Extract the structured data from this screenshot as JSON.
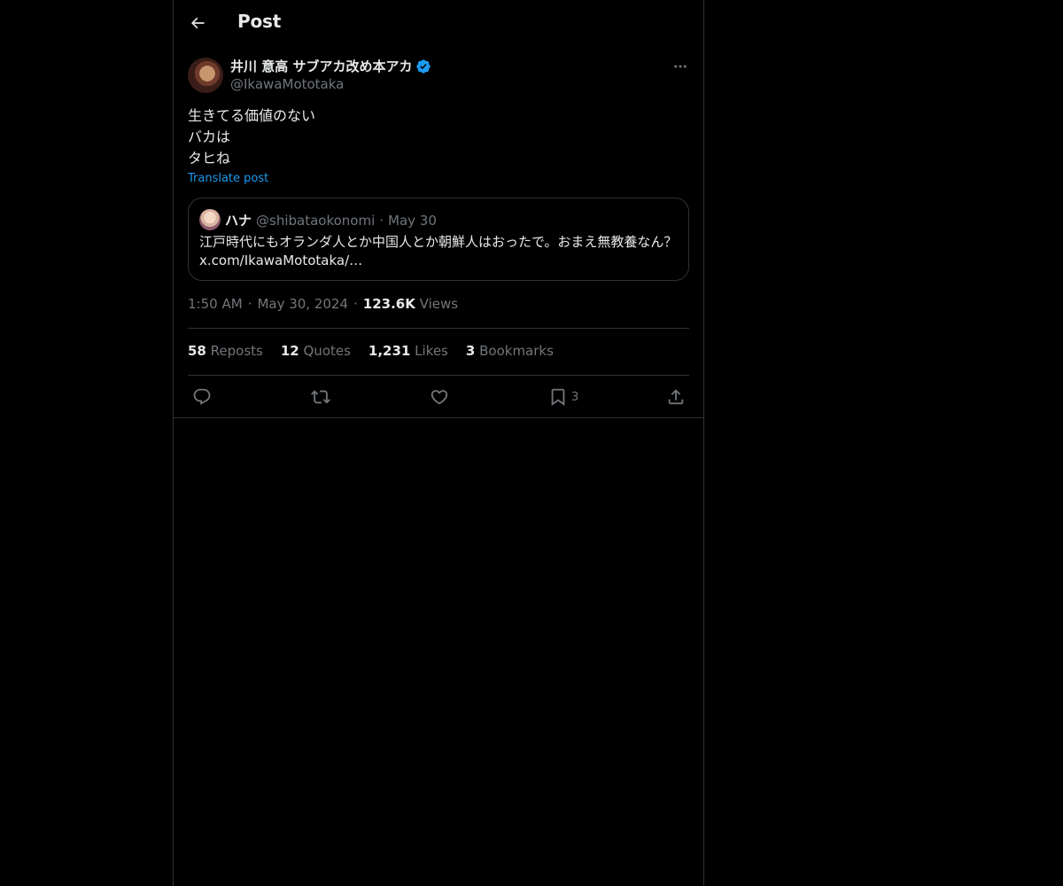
{
  "header": {
    "title": "Post",
    "back_icon": "arrow-left-icon"
  },
  "post": {
    "author": {
      "name": "井川 意高 サブアカ改め本アカ",
      "handle": "@IkawaMototaka",
      "verified": true,
      "verified_color": "#1d9bf0"
    },
    "text_lines": [
      "生きてる価値のない",
      "バカは",
      "タヒね"
    ],
    "translate_label": "Translate post",
    "quote": {
      "name": "ハナ",
      "handle": "@shibataokonomi",
      "separator": "·",
      "date": "May 30",
      "text_line1": "江戸時代にもオランダ人とか中国人とか朝鮮人はおったで。おまえ無教養なん？",
      "text_line2": "x.com/IkawaMototaka/…"
    },
    "meta": {
      "time": "1:50 AM",
      "separator": "·",
      "date": "May 30, 2024",
      "views_count": "123.6K",
      "views_label": "Views"
    },
    "stats": {
      "reposts_count": "58",
      "reposts_label": "Reposts",
      "quotes_count": "12",
      "quotes_label": "Quotes",
      "likes_count": "1,231",
      "likes_label": "Likes",
      "bookmarks_count": "3",
      "bookmarks_label": "Bookmarks"
    },
    "actions": {
      "reply_icon": "reply-icon",
      "repost_icon": "repost-icon",
      "like_icon": "heart-icon",
      "bookmark_icon": "bookmark-icon",
      "bookmark_count": "3",
      "share_icon": "share-icon"
    }
  },
  "colors": {
    "background": "#000000",
    "text_primary": "#e7e9ea",
    "text_secondary": "#71767b",
    "border": "#2f3336",
    "link": "#1d9bf0"
  }
}
